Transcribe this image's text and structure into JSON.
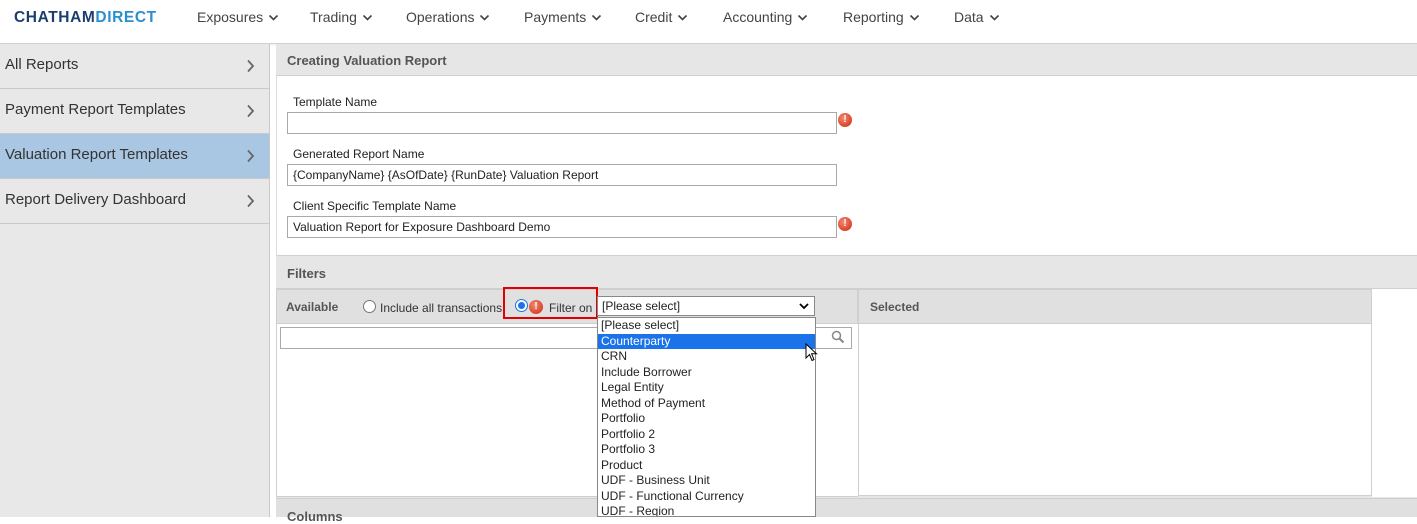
{
  "brand": {
    "part1": "CHATHAM",
    "part2": "DIRECT"
  },
  "nav": [
    "Exposures",
    "Trading",
    "Operations",
    "Payments",
    "Credit",
    "Accounting",
    "Reporting",
    "Data"
  ],
  "sidebar": {
    "items": [
      {
        "label": "All Reports",
        "active": false
      },
      {
        "label": "Payment Report Templates",
        "active": false
      },
      {
        "label": "Valuation Report Templates",
        "active": true
      },
      {
        "label": "Report Delivery Dashboard",
        "active": false
      }
    ]
  },
  "page_title": "Creating Valuation Report",
  "form": {
    "template_name_label": "Template Name",
    "template_name_value": "",
    "generated_name_label": "Generated Report Name",
    "generated_name_value": "{CompanyName} {AsOfDate} {RunDate} Valuation Report",
    "client_name_label": "Client Specific Template Name",
    "client_name_value": "Valuation Report for Exposure Dashboard Demo"
  },
  "filters": {
    "title": "Filters",
    "available_label": "Available",
    "include_all_label": "Include all transactions",
    "filter_on_label": "Filter on",
    "select_value": "[Please select]",
    "selected_label": "Selected",
    "options": [
      "[Please select]",
      "Counterparty",
      "CRN",
      "Include Borrower",
      "Legal Entity",
      "Method of Payment",
      "Portfolio",
      "Portfolio 2",
      "Portfolio 3",
      "Product",
      "UDF - Business Unit",
      "UDF - Functional Currency",
      "UDF - Region"
    ],
    "highlighted_option": "Counterparty"
  },
  "columns_title": "Columns",
  "colors": {
    "accent": "#1a73e8",
    "sidebar_active": "#a9c6e2",
    "error": "#d9442a",
    "highlight_box": "#e00000"
  }
}
